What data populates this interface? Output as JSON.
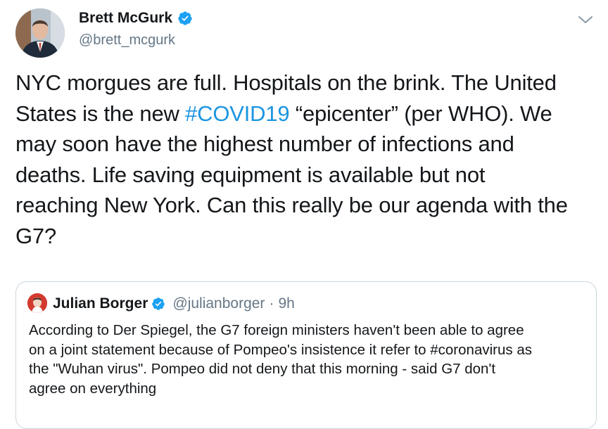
{
  "tweet": {
    "author": {
      "name": "Brett McGurk",
      "handle": "@brett_mcgurk",
      "avatar_icon": "profile-photo-icon",
      "verified_icon": "verified-badge-icon"
    },
    "menu_icon": "chevron-down-icon",
    "body": {
      "line1": "NYC morgues are full. Hospitals on the brink. The United",
      "line2_before": "States is the new ",
      "line2_hashtag": "#COVID19",
      "line2_after": " “epicenter” (per WHO). We",
      "line3": "may soon have the highest number of infections and",
      "line4": "deaths. Life saving equipment is available but not",
      "line5": "reaching New York. Can this really be our agenda with the",
      "line6": "G7?"
    },
    "quote": {
      "name": "Julian Borger",
      "handle": "@julianborger",
      "separator": "·",
      "time": "9h",
      "avatar_icon": "profile-photo-icon",
      "verified_icon": "verified-badge-icon",
      "body": {
        "line1": "According to Der Spiegel, the G7 foreign ministers haven't been able to agree",
        "line2": "on a joint statement because of Pompeo's insistence it refer to #coronavirus as",
        "line3": "the \"Wuhan virus\".  Pompeo did not deny that this morning - said G7 don't",
        "line4": "agree on everything"
      }
    },
    "colors": {
      "text": "#14171a",
      "secondary": "#657786",
      "link": "#1b95e0",
      "verified": "#1da1f2",
      "border": "#ccd6dd"
    }
  }
}
